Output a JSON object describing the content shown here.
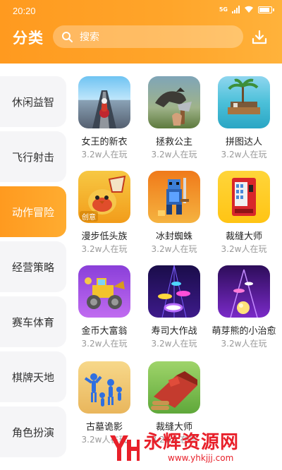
{
  "status_bar": {
    "time": "20:20",
    "network_tag": "5G",
    "battery_level": 0.9
  },
  "header": {
    "title": "分类",
    "search_placeholder": "搜索"
  },
  "sidebar": {
    "active_index": 2,
    "items": [
      {
        "label": "休闲益智"
      },
      {
        "label": "飞行射击"
      },
      {
        "label": "动作冒险"
      },
      {
        "label": "经营策略"
      },
      {
        "label": "赛车体育"
      },
      {
        "label": "棋牌天地"
      },
      {
        "label": "角色扮演"
      }
    ]
  },
  "apps": [
    {
      "name": "女王的新衣",
      "players": "3.2w人在玩",
      "icon": "moto-racing-icon"
    },
    {
      "name": "拯救公主",
      "players": "3.2w人在玩",
      "icon": "dinosaur-icon"
    },
    {
      "name": "拼图达人",
      "players": "3.2w人在玩",
      "icon": "raft-island-icon"
    },
    {
      "name": "漫步低头族",
      "players": "3.2w人在玩",
      "icon": "bird-mascot-icon",
      "badge": "创意"
    },
    {
      "name": "冰封蜘蛛",
      "players": "3.2w人在玩",
      "icon": "pixel-knight-icon"
    },
    {
      "name": "裁缝大师",
      "players": "3.2w人在玩",
      "icon": "vending-machine-icon"
    },
    {
      "name": "金币大富翁",
      "players": "3.2w人在玩",
      "icon": "bulldozer-icon"
    },
    {
      "name": "寿司大作战",
      "players": "3.2w人在玩",
      "icon": "music-tiles-icon"
    },
    {
      "name": "萌芽熊的小治愈",
      "players": "3.2w人在玩",
      "icon": "rolling-ball-icon"
    },
    {
      "name": "古墓诡影",
      "players": "3.2w人在玩",
      "icon": "stickman-crowd-icon"
    },
    {
      "name": "裁缝大师",
      "players": "3.2w人在玩",
      "icon": "log-harvester-icon"
    }
  ],
  "watermark": {
    "title": "永辉资源网",
    "url": "www.yhkjjj.com"
  },
  "colors": {
    "accent": "#ffa52a",
    "watermark": "#e8202a"
  }
}
